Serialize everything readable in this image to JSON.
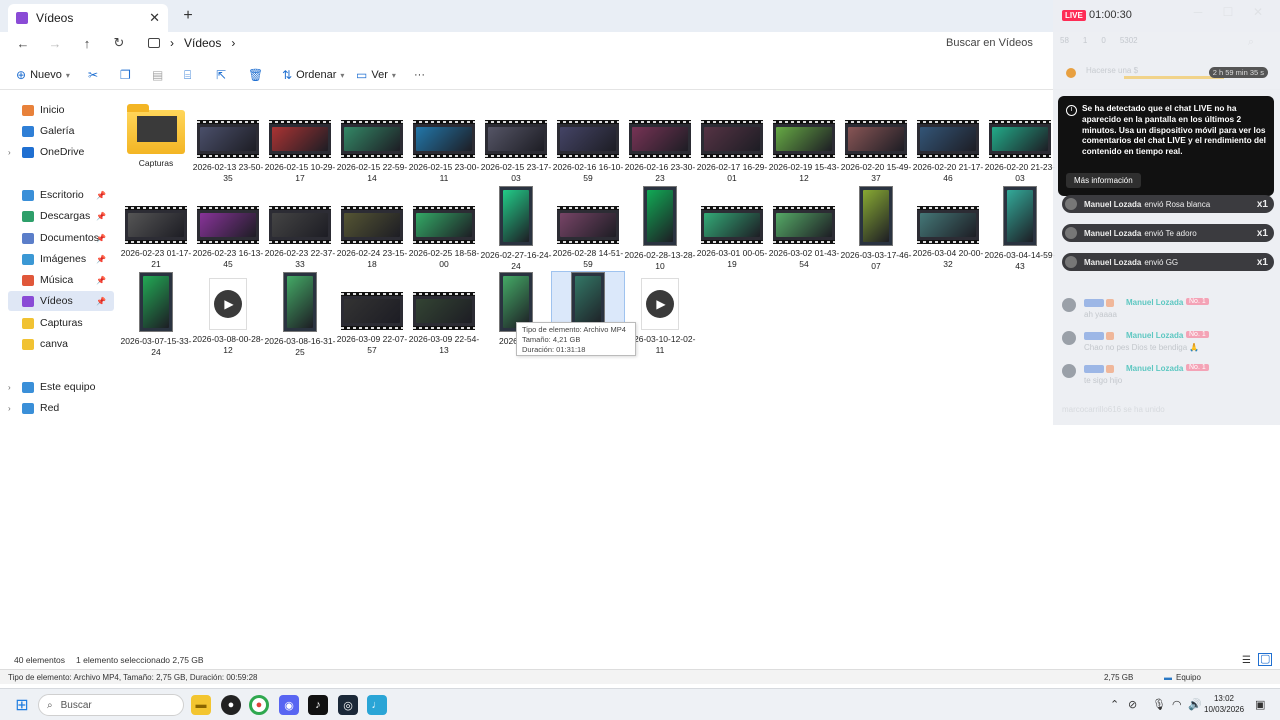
{
  "window": {
    "tab_title": "Vídeos",
    "tab_close": "✕",
    "new_tab": "+",
    "minimize": "─",
    "maximize": "☐",
    "close": "✕"
  },
  "address": {
    "breadcrumb": "Vídeos",
    "separator": "›",
    "search_placeholder": "Buscar en Vídeos"
  },
  "toolbar": {
    "new_label": "Nuevo",
    "sort_label": "Ordenar",
    "view_label": "Ver",
    "more_label": "···"
  },
  "sidebar": {
    "items": [
      {
        "label": "Inicio",
        "color": "#e8813a"
      },
      {
        "label": "Galería",
        "color": "#2f7fd6"
      },
      {
        "label": "OneDrive",
        "color": "#1f6fd1"
      },
      {
        "label": "Escritorio",
        "color": "#3a8fd8"
      },
      {
        "label": "Descargas",
        "color": "#2e9f6a"
      },
      {
        "label": "Documentos",
        "color": "#5b7ec9"
      },
      {
        "label": "Imágenes",
        "color": "#3b98d4"
      },
      {
        "label": "Música",
        "color": "#e0573a"
      },
      {
        "label": "Vídeos",
        "color": "#8a4bd6"
      },
      {
        "label": "Capturas",
        "color": "#f1c232"
      },
      {
        "label": "canva",
        "color": "#f1c232"
      },
      {
        "label": "Este equipo",
        "color": "#3a8fd8"
      },
      {
        "label": "Red",
        "color": "#3a8fd8"
      }
    ]
  },
  "files": [
    {
      "name": "Capturas"
    },
    {
      "name": "2026-02-13 23-50-35"
    },
    {
      "name": "2026-02-15 10-29-17"
    },
    {
      "name": "2026-02-15 22-59-14"
    },
    {
      "name": "2026-02-15 23-00-11"
    },
    {
      "name": "2026-02-15 23-17-03"
    },
    {
      "name": "2026-02-16 16-10-59"
    },
    {
      "name": "2026-02-16 23-30-23"
    },
    {
      "name": "2026-02-17 16-29-01"
    },
    {
      "name": "2026-02-19 15-43-12"
    },
    {
      "name": "2026-02-20 15-49-37"
    },
    {
      "name": "2026-02-20 21-17-46"
    },
    {
      "name": "2026-02-20 21-23-03"
    },
    {
      "name": "2026-02-23 01-17-21"
    },
    {
      "name": "2026-02-23 16-13-45"
    },
    {
      "name": "2026-02-23 22-37-33"
    },
    {
      "name": "2026-02-24 23-15-18"
    },
    {
      "name": "2026-02-25 18-58-00"
    },
    {
      "name": "2026-02-27-16-24-24"
    },
    {
      "name": "2026-02-28 14-51-59"
    },
    {
      "name": "2026-02-28-13-28-10"
    },
    {
      "name": "2026-03-01 00-05-19"
    },
    {
      "name": "2026-03-02 01-43-54"
    },
    {
      "name": "2026-03-03-17-46-07"
    },
    {
      "name": "2026-03-04 20-00-32"
    },
    {
      "name": "2026-03-04-14-59-43"
    },
    {
      "name": "2026-03-07-15-33-24"
    },
    {
      "name": "2026-03-08-00-28-12"
    },
    {
      "name": "2026-03-08-16-31-25"
    },
    {
      "name": "2026-03-09 22-07-57"
    },
    {
      "name": "2026-03-09 22-54-13"
    },
    {
      "name": "2026-03-"
    },
    {
      "name": ""
    },
    {
      "name": "2026-03-10-12-02-11"
    }
  ],
  "tooltip": {
    "line1": "Tipo de elemento: Archivo MP4",
    "line2": "Tamaño: 4,21 GB",
    "line3": "Duración: 01:31:18"
  },
  "status": {
    "count": "40 elementos",
    "selected": "1 elemento seleccionado  2,75 GB",
    "details": "Tipo de elemento: Archivo MP4, Tamaño: 2,75 GB, Duración: 00:59:28",
    "size": "2,75 GB",
    "computer": "Equipo"
  },
  "taskbar": {
    "search_label": "Buscar",
    "time": "13:02",
    "date": "10/03/2026"
  },
  "live": {
    "badge": "LIVE",
    "timer": "01:00:30",
    "stats": [
      "58",
      "1",
      "0",
      "5302"
    ],
    "gift_label": "Hacerse una $",
    "gift_timer": "2 h 59 min 35 s",
    "notice_text": "Se ha detectado que el chat LIVE no ha aparecido en la pantalla en los últimos 2 minutos. Usa un dispositivo móvil para ver los comentarios del chat LIVE y el rendimiento del contenido en tiempo real.",
    "notice_button": "Más información",
    "gifts": [
      {
        "user": "Manuel Lozada",
        "text": "envió Rosa blanca",
        "count": "x1"
      },
      {
        "user": "Manuel Lozada",
        "text": "envió Te adoro",
        "count": "x1"
      },
      {
        "user": "Manuel Lozada",
        "text": "envió GG",
        "count": "x1"
      }
    ],
    "chat": [
      {
        "user": "Manuel Lozada",
        "badge": "No. 1",
        "msg": "ah yaaaa"
      },
      {
        "user": "Manuel Lozada",
        "badge": "No. 1",
        "msg": "Chao no pes Dios te bendiga 🙏"
      },
      {
        "user": "Manuel Lozada",
        "badge": "No. 1",
        "msg": "te sigo hijo"
      }
    ],
    "joined": "marcocarrillo616  se ha unido"
  }
}
